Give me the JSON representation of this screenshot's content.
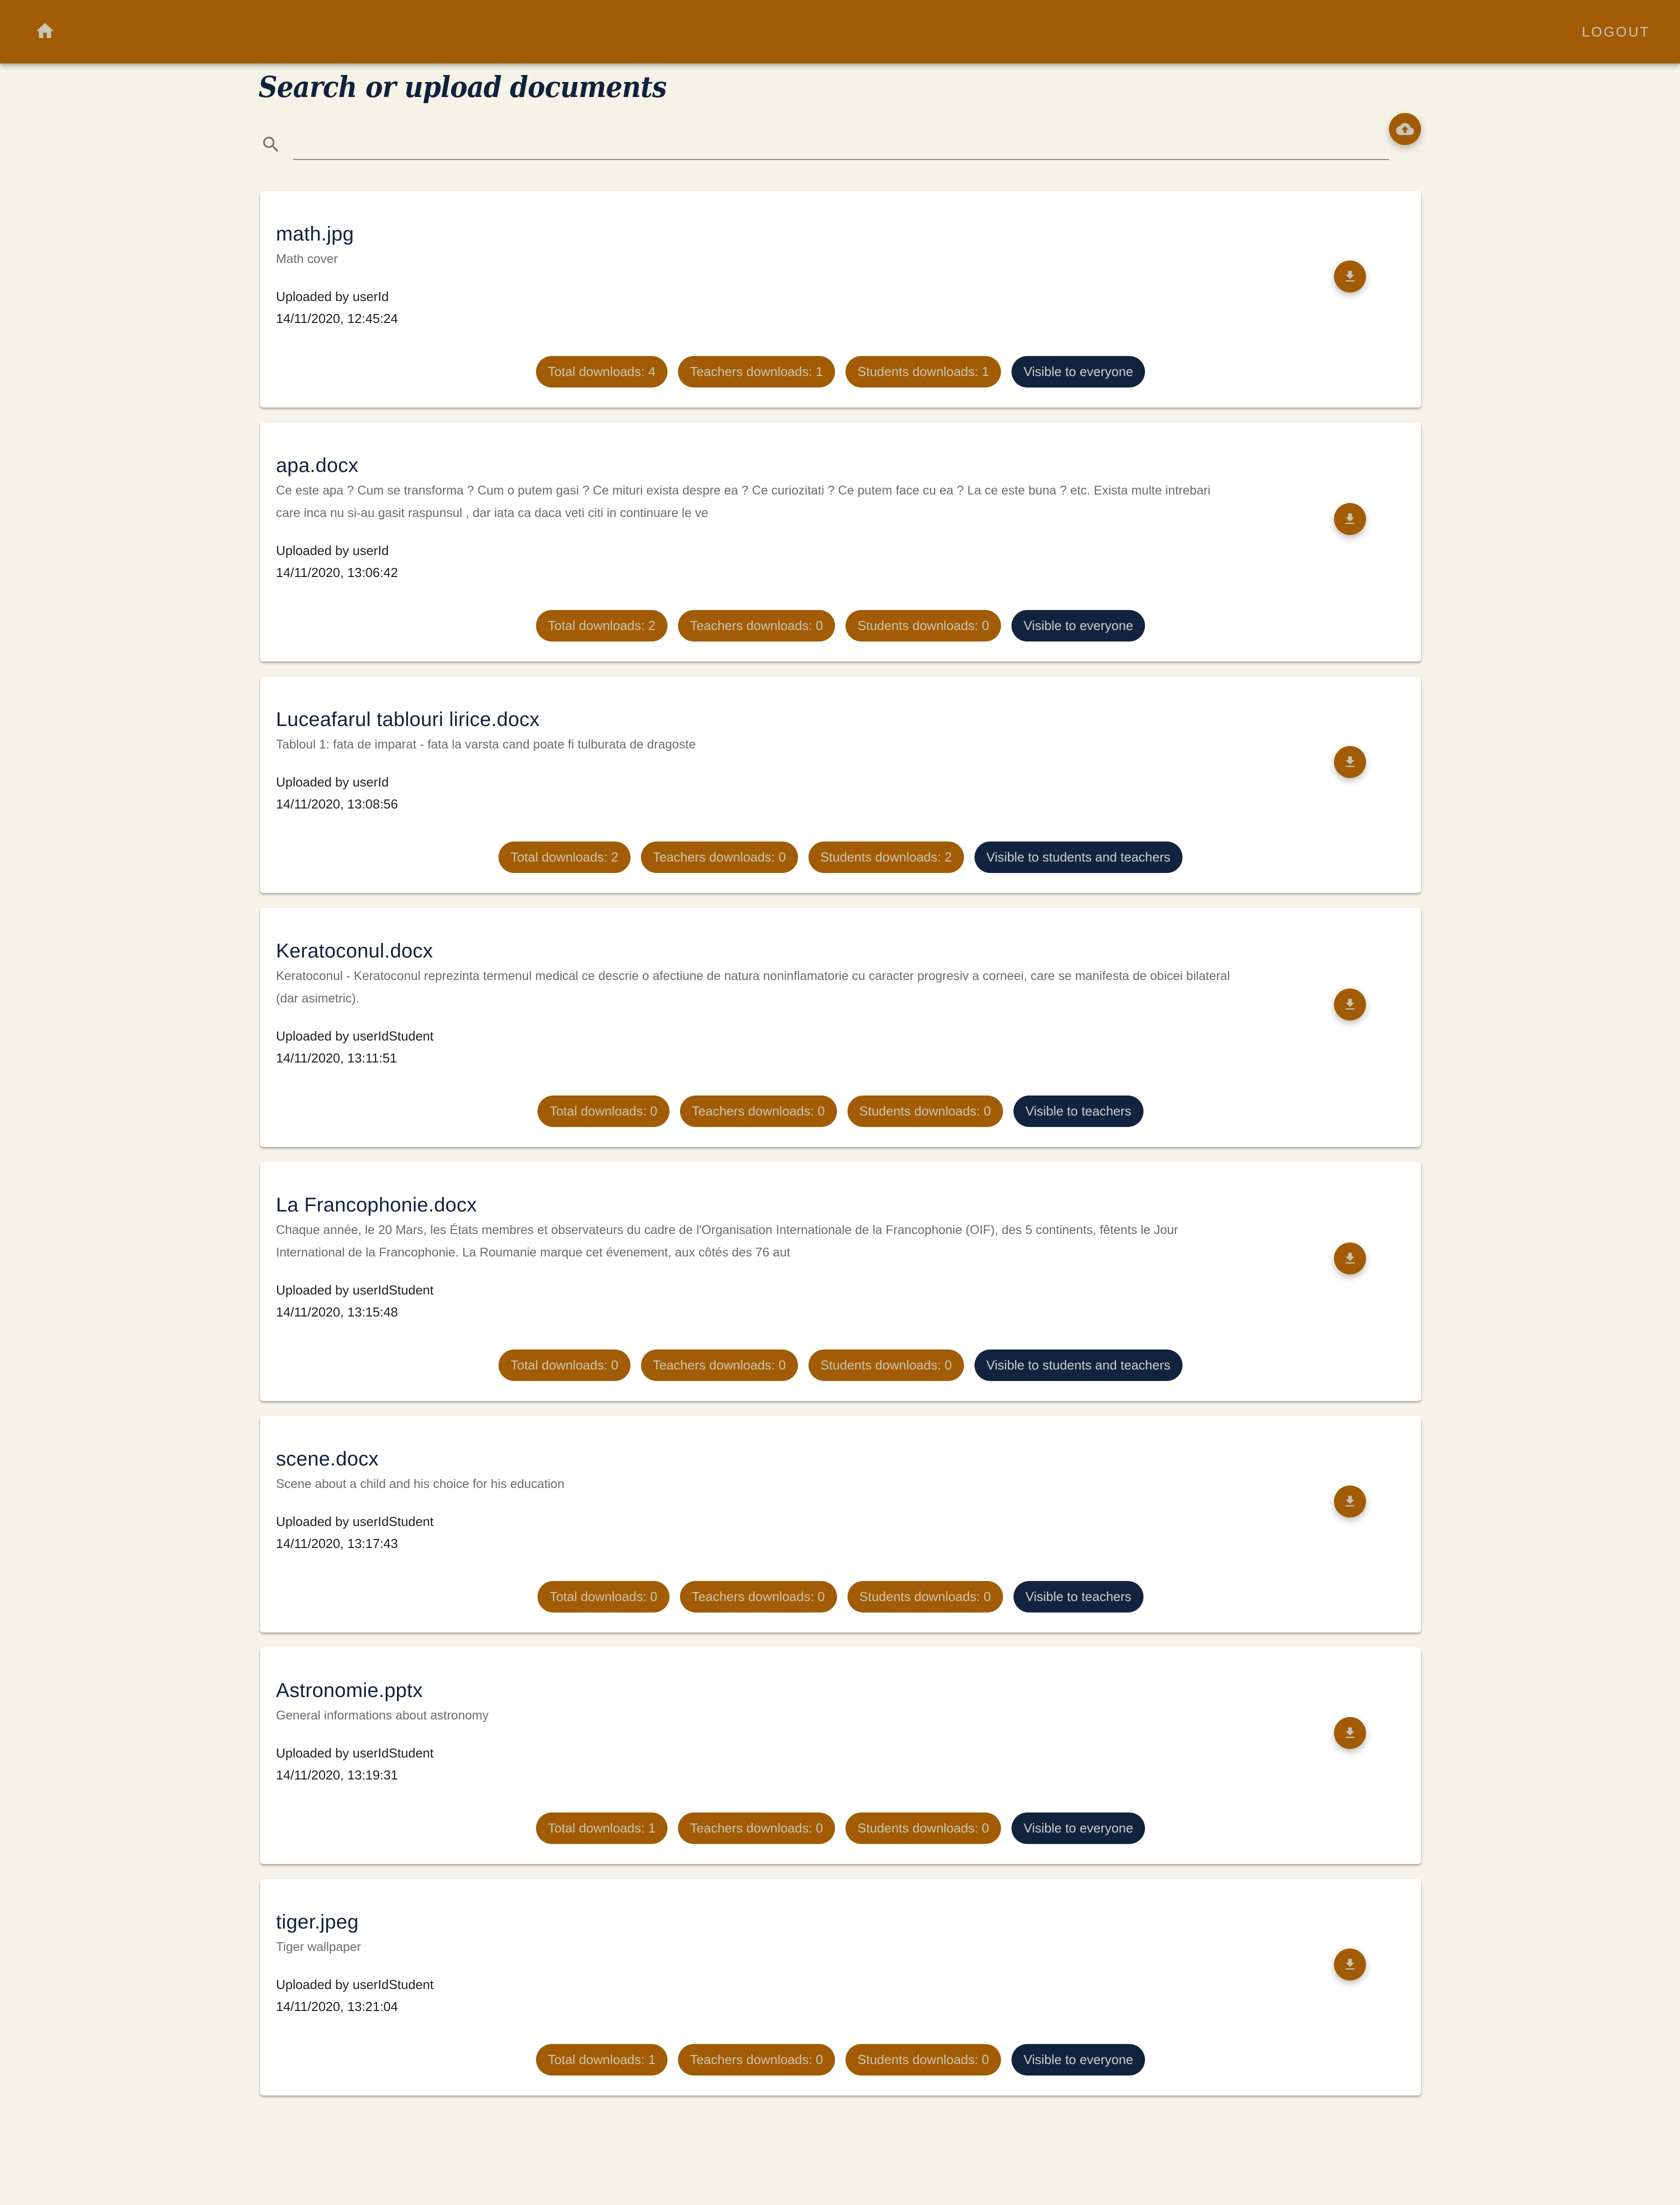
{
  "topbar": {
    "home_icon": "home-icon",
    "logout_label": "LOGOUT",
    "accent_color": "#a15c05"
  },
  "header": {
    "title": "Search or upload documents",
    "search": {
      "value": "",
      "placeholder": "",
      "icon": "search-icon"
    },
    "upload_icon": "cloud-upload-icon"
  },
  "documents": [
    {
      "name": "math.jpg",
      "description": "Math cover",
      "uploader": "Uploaded by userId",
      "date": "14/11/2020, 12:45:24",
      "total_downloads": "Total downloads: 4",
      "teachers_downloads": "Teachers downloads: 1",
      "students_downloads": "Students downloads: 1",
      "visibility": "Visible to everyone"
    },
    {
      "name": "apa.docx",
      "description": "Ce este apa ? Cum se transforma ? Cum o putem gasi ? Ce mituri exista despre ea ? Ce curiozitati ? Ce putem face cu ea ? La ce este buna ? etc. Exista multe intrebari care inca nu si-au gasit raspunsul , dar iata ca daca veti citi in continuare le ve",
      "uploader": "Uploaded by userId",
      "date": "14/11/2020, 13:06:42",
      "total_downloads": "Total downloads: 2",
      "teachers_downloads": "Teachers downloads: 0",
      "students_downloads": "Students downloads: 0",
      "visibility": "Visible to everyone"
    },
    {
      "name": "Luceafarul tablouri lirice.docx",
      "description": "Tabloul 1: fata de imparat - fata la varsta cand poate fi tulburata de dragoste",
      "uploader": "Uploaded by userId",
      "date": "14/11/2020, 13:08:56",
      "total_downloads": "Total downloads: 2",
      "teachers_downloads": "Teachers downloads: 0",
      "students_downloads": "Students downloads: 2",
      "visibility": "Visible to students and teachers"
    },
    {
      "name": "Keratoconul.docx",
      "description": "Keratoconul - Keratoconul reprezinta termenul medical ce descrie o afectiune de natura noninflamatorie cu caracter progresiv a corneei, care se manifesta de obicei bilateral (dar asimetric).",
      "uploader": "Uploaded by userIdStudent",
      "date": "14/11/2020, 13:11:51",
      "total_downloads": "Total downloads: 0",
      "teachers_downloads": "Teachers downloads: 0",
      "students_downloads": "Students downloads: 0",
      "visibility": "Visible to teachers"
    },
    {
      "name": "La Francophonie.docx",
      "description": "Chaque année, le 20 Mars, les États membres et observateurs du cadre de l'Organisation Internationale de la Francophonie (OIF), des 5 continents, fêtents le Jour International de la Francophonie. La Roumanie marque cet évenement, aux côtés des 76 aut",
      "uploader": "Uploaded by userIdStudent",
      "date": "14/11/2020, 13:15:48",
      "total_downloads": "Total downloads: 0",
      "teachers_downloads": "Teachers downloads: 0",
      "students_downloads": "Students downloads: 0",
      "visibility": "Visible to students and teachers"
    },
    {
      "name": "scene.docx",
      "description": "Scene about a child and his choice for his education",
      "uploader": "Uploaded by userIdStudent",
      "date": "14/11/2020, 13:17:43",
      "total_downloads": "Total downloads: 0",
      "teachers_downloads": "Teachers downloads: 0",
      "students_downloads": "Students downloads: 0",
      "visibility": "Visible to teachers"
    },
    {
      "name": "Astronomie.pptx",
      "description": "General informations about astronomy",
      "uploader": "Uploaded by userIdStudent",
      "date": "14/11/2020, 13:19:31",
      "total_downloads": "Total downloads: 1",
      "teachers_downloads": "Teachers downloads: 0",
      "students_downloads": "Students downloads: 0",
      "visibility": "Visible to everyone"
    },
    {
      "name": "tiger.jpeg",
      "description": "Tiger wallpaper",
      "uploader": "Uploaded by userIdStudent",
      "date": "14/11/2020, 13:21:04",
      "total_downloads": "Total downloads: 1",
      "teachers_downloads": "Teachers downloads: 0",
      "students_downloads": "Students downloads: 0",
      "visibility": "Visible to everyone"
    }
  ],
  "colors": {
    "accent": "#a15c05",
    "navy": "#11233f",
    "background": "#f5f3e7",
    "card": "#ffffff"
  }
}
